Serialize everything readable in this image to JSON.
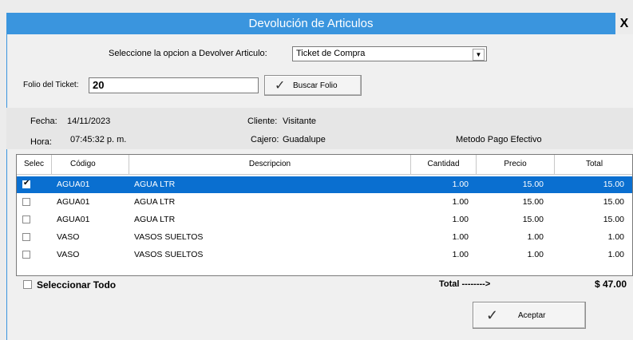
{
  "window": {
    "title": "Devolución de Articulos",
    "close_label": "X"
  },
  "form": {
    "option_label": "Seleccione la  opcion a Devolver Articulo:",
    "option_value": "Ticket de Compra",
    "folio_label": "Folio del Ticket:",
    "folio_value": "20",
    "search_button": "Buscar Folio"
  },
  "info": {
    "fecha_label": "Fecha:",
    "fecha_value": "14/11/2023",
    "hora_label": "Hora:",
    "hora_value": "07:45:32 p. m.",
    "cliente_label": "Cliente:",
    "cliente_value": "Visitante",
    "cajero_label": "Cajero:",
    "cajero_value": "Guadalupe",
    "metodo": "Metodo Pago Efectivo"
  },
  "table": {
    "columns": [
      "Selec",
      "Código",
      "Descripcion",
      "Cantidad",
      "Precio",
      "Total"
    ],
    "rows": [
      {
        "checked": true,
        "codigo": "AGUA01",
        "descripcion": "AGUA LTR",
        "cantidad": "1.00",
        "precio": "15.00",
        "total": "15.00"
      },
      {
        "checked": false,
        "codigo": "AGUA01",
        "descripcion": "AGUA LTR",
        "cantidad": "1.00",
        "precio": "15.00",
        "total": "15.00"
      },
      {
        "checked": false,
        "codigo": "AGUA01",
        "descripcion": "AGUA LTR",
        "cantidad": "1.00",
        "precio": "15.00",
        "total": "15.00"
      },
      {
        "checked": false,
        "codigo": "VASO",
        "descripcion": "VASOS SUELTOS",
        "cantidad": "1.00",
        "precio": "1.00",
        "total": "1.00"
      },
      {
        "checked": false,
        "codigo": "VASO",
        "descripcion": "VASOS SUELTOS",
        "cantidad": "1.00",
        "precio": "1.00",
        "total": "1.00"
      }
    ]
  },
  "footer": {
    "select_all": "Seleccionar Todo",
    "total_label": "Total -------->",
    "total_value": "$ 47.00",
    "accept_button": "Aceptar"
  },
  "colors": {
    "title_bar": "#3a95de",
    "selected_row": "#0a6fd0"
  }
}
